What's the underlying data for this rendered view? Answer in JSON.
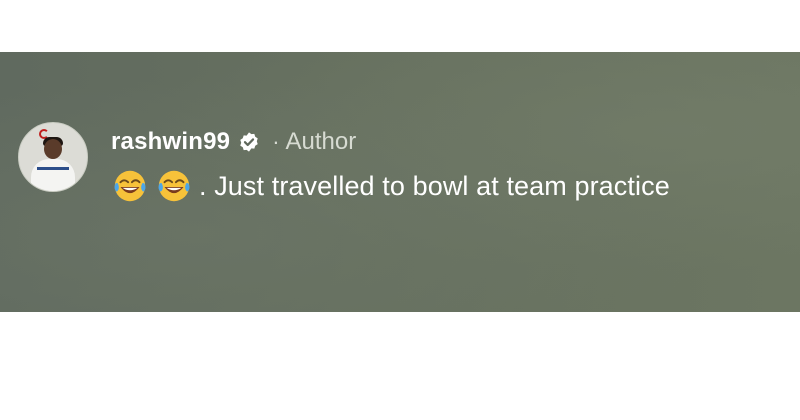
{
  "comment": {
    "username": "rashwin99",
    "separator": "·",
    "role_label": "Author",
    "emojis": [
      "tears-of-joy-emoji",
      "tears-of-joy-emoji"
    ],
    "text": ". Just travelled to bowl at team practice",
    "verified_icon": "verified-badge-icon",
    "avatar": "user-avatar"
  },
  "colors": {
    "banner_bg": "#66705f",
    "text_primary": "#ffffff",
    "text_secondary": "#d7dbd2",
    "emoji_face": "#f7c23a",
    "emoji_tear": "#4da6e8"
  }
}
